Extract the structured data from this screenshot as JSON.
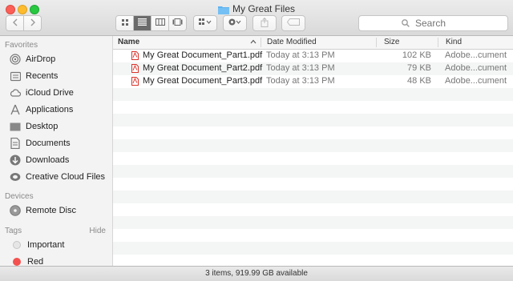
{
  "window": {
    "title": "My Great Files"
  },
  "toolbar": {
    "search_placeholder": "Search"
  },
  "sidebar": {
    "favorites_header": "Favorites",
    "favorites": [
      {
        "label": "AirDrop",
        "icon": "airdrop-icon"
      },
      {
        "label": "Recents",
        "icon": "recents-icon"
      },
      {
        "label": "iCloud Drive",
        "icon": "cloud-icon"
      },
      {
        "label": "Applications",
        "icon": "applications-icon"
      },
      {
        "label": "Desktop",
        "icon": "desktop-icon"
      },
      {
        "label": "Documents",
        "icon": "documents-icon"
      },
      {
        "label": "Downloads",
        "icon": "downloads-icon"
      },
      {
        "label": "Creative Cloud Files",
        "icon": "creative-cloud-icon"
      }
    ],
    "devices_header": "Devices",
    "devices": [
      {
        "label": "Remote Disc",
        "icon": "disc-icon"
      }
    ],
    "tags_header": "Tags",
    "tags_hide": "Hide",
    "tags": [
      {
        "label": "Important",
        "color": "#e6e6e6"
      },
      {
        "label": "Red",
        "color": "#f2514f"
      }
    ]
  },
  "columns": {
    "name": "Name",
    "date": "Date Modified",
    "size": "Size",
    "kind": "Kind"
  },
  "files": [
    {
      "name": "My Great Document_Part1.pdf",
      "date": "Today at 3:13 PM",
      "size": "102 KB",
      "kind": "Adobe...cument"
    },
    {
      "name": "My Great Document_Part2.pdf",
      "date": "Today at 3:13 PM",
      "size": "79 KB",
      "kind": "Adobe...cument"
    },
    {
      "name": "My Great Document_Part3.pdf",
      "date": "Today at 3:13 PM",
      "size": "48 KB",
      "kind": "Adobe...cument"
    }
  ],
  "status": "3 items, 919.99 GB available",
  "colors": {
    "pdf_red": "#d9352c",
    "folder_blue": "#5fb2ef"
  }
}
